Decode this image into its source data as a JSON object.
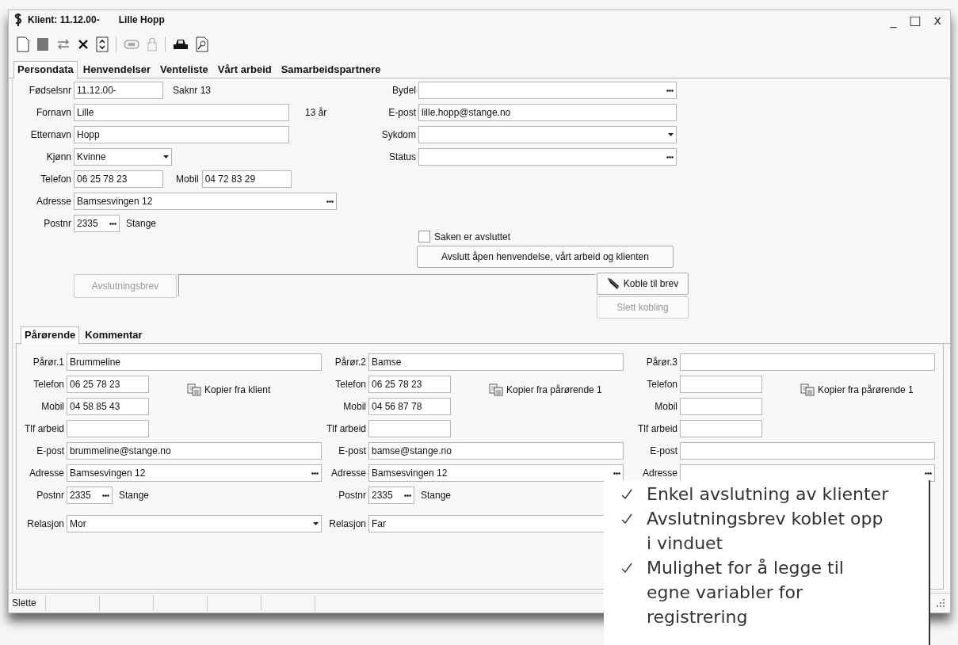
{
  "window": {
    "title": "Klient: 11.12.00-",
    "subtitle": "Lille Hopp",
    "controls": [
      "_",
      "□",
      "x"
    ]
  },
  "tabs": [
    {
      "label": "Persondata",
      "selected": true
    },
    {
      "label": "Henvendelser",
      "selected": false
    },
    {
      "label": "Venteliste",
      "selected": false
    },
    {
      "label": "Vårt arbeid",
      "selected": false
    },
    {
      "label": "Samarbeidspartnere",
      "selected": false
    }
  ],
  "person": {
    "left": [
      {
        "label": "Fødselsnr",
        "kind": "short",
        "value": "11.12.00-",
        "note": "Saknr 13"
      },
      {
        "label": "Fornavn",
        "kind": "text",
        "value": "Lille",
        "note": "13 år"
      },
      {
        "label": "Etternavn",
        "kind": "text",
        "value": "Hopp"
      },
      {
        "label": "Kjønn",
        "kind": "dropdown",
        "value": "Kvinne"
      },
      {
        "label": "Telefon",
        "kind": "short",
        "value": "06 25 78 23",
        "second": {
          "label": "Mobil",
          "value": "04 72 83 29"
        }
      },
      {
        "label": "Adresse",
        "kind": "lookup",
        "value": "Bamsesvingen 12"
      },
      {
        "label": "Postnr",
        "kind": "postcode",
        "value": "2335",
        "place": "Stange"
      }
    ],
    "right": [
      {
        "label": "Bydel",
        "kind": "lookup"
      },
      {
        "label": "E-post",
        "kind": "text",
        "value": "lille.hopp@stange.no"
      },
      {
        "label": "Sykdom",
        "kind": "dropdown"
      },
      {
        "label": "Status",
        "kind": "lookup"
      }
    ],
    "closed_checkbox": {
      "label": "Saken er avsluttet",
      "checked": false
    },
    "close_all_button": "Avslutt åpen henvendelse, vårt arbeid og klienten",
    "letter": {
      "button": {
        "label": "Avslutningsbrev",
        "disabled": true
      },
      "link_button": {
        "label": "Koble til brev",
        "disabled": false
      },
      "unlink_button": {
        "label": "Slett kobling",
        "disabled": true
      }
    }
  },
  "sub_tabs": [
    {
      "label": "Pårørende",
      "selected": true
    },
    {
      "label": "Kommentar",
      "selected": false
    }
  ],
  "relatives": [
    {
      "fields": [
        {
          "label": "Pårør.1",
          "kind": "text",
          "value": "Brummeline"
        },
        {
          "label": "Telefon",
          "kind": "short",
          "value": "06 25 78 23",
          "action": "Kopier fra klient"
        },
        {
          "label": "Mobil",
          "kind": "short",
          "value": "04 58 85 43"
        },
        {
          "label": "Tlf arbeid",
          "kind": "short"
        },
        {
          "label": "E-post",
          "kind": "text",
          "value": "brummeline@stange.no"
        },
        {
          "label": "Adresse",
          "kind": "lookup",
          "value": "Bamsesvingen 12"
        },
        {
          "label": "Postnr",
          "kind": "postcode",
          "value": "2335",
          "place": "Stange"
        },
        {
          "label": "Relasjon",
          "kind": "dropdown",
          "value": "Mor"
        }
      ]
    },
    {
      "fields": [
        {
          "label": "Pårør.2",
          "kind": "text",
          "value": "Bamse"
        },
        {
          "label": "Telefon",
          "kind": "short",
          "value": "06 25 78 23",
          "action": "Kopier fra pårørende 1"
        },
        {
          "label": "Mobil",
          "kind": "short",
          "value": "04 56 87 78"
        },
        {
          "label": "Tlf arbeid",
          "kind": "short"
        },
        {
          "label": "E-post",
          "kind": "text",
          "value": "bamse@stange.no"
        },
        {
          "label": "Adresse",
          "kind": "lookup",
          "value": "Bamsesvingen 12"
        },
        {
          "label": "Postnr",
          "kind": "postcode",
          "value": "2335",
          "place": "Stange"
        },
        {
          "label": "Relasjon",
          "kind": "dropdown",
          "value": "Far"
        }
      ]
    },
    {
      "fields": [
        {
          "label": "Pårør.3",
          "kind": "text"
        },
        {
          "label": "Telefon",
          "kind": "short",
          "action": "Kopier fra pårørende 1"
        },
        {
          "label": "Mobil",
          "kind": "short"
        },
        {
          "label": "Tlf arbeid",
          "kind": "short"
        },
        {
          "label": "E-post",
          "kind": "text"
        },
        {
          "label": "Adresse",
          "kind": "lookup"
        }
      ]
    }
  ],
  "status_bar": {
    "text": "Slette"
  },
  "callout": {
    "items": [
      "Enkel avslutning av klienter",
      "Avslutningsbrev koblet opp i vinduet",
      "Mulighet for å legge til egne variabler for registrering"
    ]
  }
}
